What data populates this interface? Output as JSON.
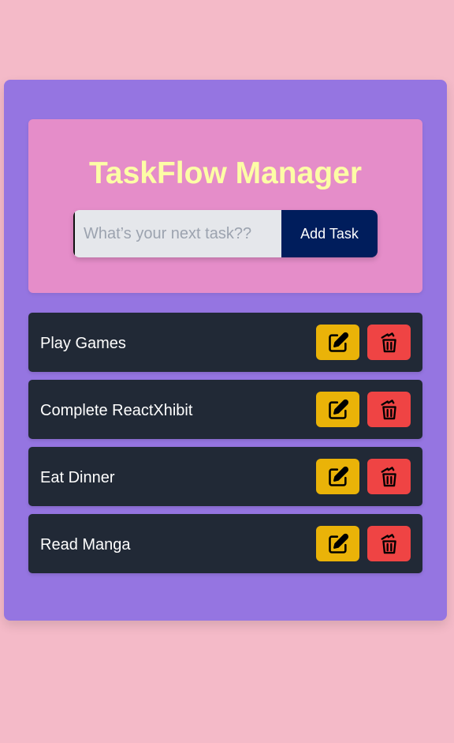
{
  "header": {
    "title": "TaskFlow Manager"
  },
  "form": {
    "input_value": "",
    "input_placeholder": "What’s your next task??",
    "add_label": "Add Task"
  },
  "tasks": [
    {
      "label": "Play Games",
      "edit_icon": "edit-icon",
      "delete_icon": "trash-icon"
    },
    {
      "label": "Complete ReactXhibit",
      "edit_icon": "edit-icon",
      "delete_icon": "trash-icon"
    },
    {
      "label": "Eat Dinner",
      "edit_icon": "edit-icon",
      "delete_icon": "trash-icon"
    },
    {
      "label": "Read Manga",
      "edit_icon": "edit-icon",
      "delete_icon": "trash-icon"
    }
  ],
  "colors": {
    "page_background": "#f4bac8",
    "card_background": "#9575e1",
    "header_background": "#e58dc9",
    "title_color": "#fdfda6",
    "add_button": "#001d5c",
    "task_background": "#212936",
    "edit_button": "#eab308",
    "delete_button": "#ef4444"
  }
}
